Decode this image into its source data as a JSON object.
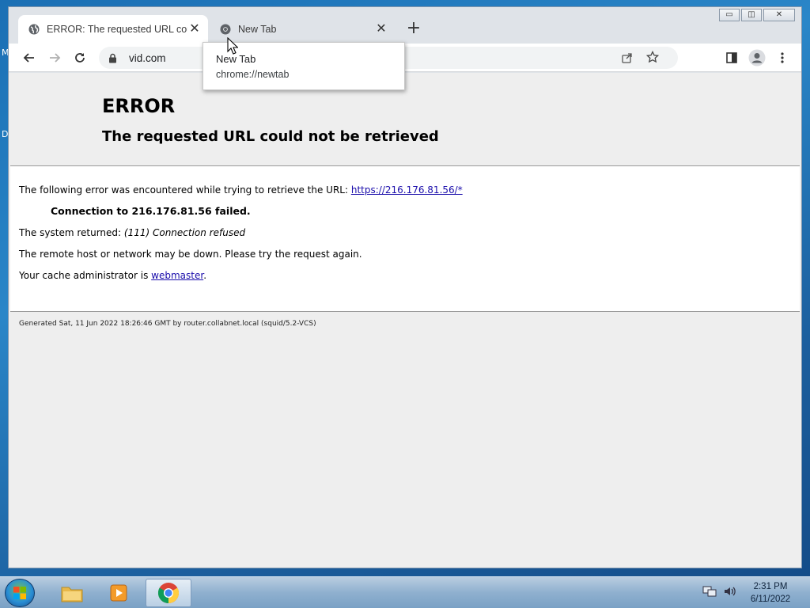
{
  "desktop": {
    "edge_letters": [
      "M",
      "D"
    ]
  },
  "window": {
    "controls": {
      "minimize": "▭",
      "restore": "◫",
      "close": "✕"
    }
  },
  "tabs": [
    {
      "title": "ERROR: The requested URL could not be retrieved",
      "icon": "globe-icon",
      "active": true
    },
    {
      "title": "New Tab",
      "icon": "chrome-icon",
      "active": false
    }
  ],
  "new_tab_label": "+",
  "toolbar": {
    "url": "vid.com"
  },
  "hovercard": {
    "title": "New Tab",
    "url": "chrome://newtab"
  },
  "page": {
    "heading": "ERROR",
    "subheading": "The requested URL could not be retrieved",
    "line1_text": "The following error was encountered while trying to retrieve the URL: ",
    "line1_link": "https://216.176.81.56/*",
    "line2": "Connection to 216.176.81.56 failed.",
    "line3_text": "The system returned: ",
    "line3_em": "(111) Connection refused",
    "line4": "The remote host or network may be down. Please try the request again.",
    "line5_text": "Your cache administrator is ",
    "line5_link": "webmaster",
    "line5_end": ".",
    "footer": "Generated Sat, 11 Jun 2022 18:26:46 GMT by router.collabnet.local (squid/5.2-VCS)"
  },
  "taskbar": {
    "time": "2:31 PM",
    "date": "6/11/2022"
  },
  "colors": {
    "link": "#1a0dab",
    "page_bg": "#eeeeee"
  }
}
